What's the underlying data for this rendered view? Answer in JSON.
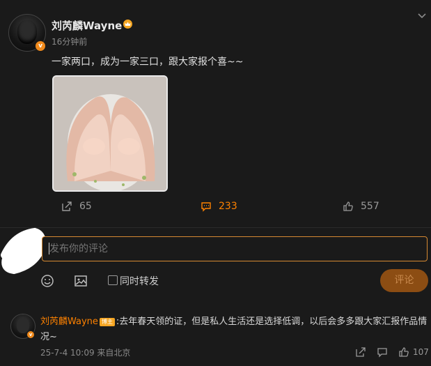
{
  "post": {
    "author": "刘芮麟Wayne",
    "verified_badge": "v",
    "time": "16分钟前",
    "text": "一家两口，成为一家三口，跟大家报个喜~~",
    "photo_icon": "baby-hands-heart-photo"
  },
  "actions": {
    "share_count": "65",
    "comment_count": "233",
    "like_count": "557"
  },
  "comment_box": {
    "placeholder": "发布你的评论",
    "repost_label": "同时转发",
    "submit_label": "评论"
  },
  "comment": {
    "author": "刘芮麟Wayne",
    "tag": "博主",
    "text": ":去年春天领的证，但是私人生活还是选择低调，以后会多多跟大家汇报作品情况~",
    "meta": "25-7-4 10:09 来自北京",
    "like_count": "107"
  },
  "colors": {
    "background": "#1a1a1a",
    "accent": "#ff8200",
    "submit_bg": "#8c4d13"
  }
}
